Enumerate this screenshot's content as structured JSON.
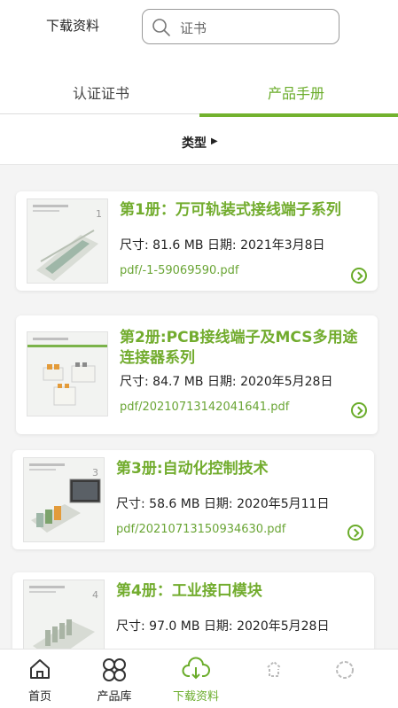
{
  "header": {
    "title": "下载资料",
    "search_placeholder": "证书"
  },
  "tabs": [
    {
      "label": "认证证书",
      "active": false
    },
    {
      "label": "产品手册",
      "active": true
    }
  ],
  "filter": {
    "label": "类型",
    "arrow": "▶"
  },
  "items": [
    {
      "title": "第1册：万可轨装式接线端子系列",
      "size_label": "尺寸: 81.6 MB",
      "date_label": "日期: 2021年3月8日",
      "path": "pdf/-1-59069590.pdf",
      "thumb_num": "1"
    },
    {
      "title": "第2册:PCB接线端子及MCS多用途连接器系列",
      "size_label": "尺寸: 84.7 MB",
      "date_label": "日期: 2020年5月28日",
      "path": "pdf/20210713142041641.pdf",
      "thumb_num": ""
    },
    {
      "title": "第3册:自动化控制技术",
      "size_label": "尺寸: 58.6 MB",
      "date_label": "日期: 2020年5月11日",
      "path": "pdf/20210713150934630.pdf",
      "thumb_num": "3"
    },
    {
      "title": "第4册：工业接口模块",
      "size_label": "尺寸: 97.0 MB",
      "date_label": "日期: 2020年5月28日",
      "path": "",
      "thumb_num": "4"
    }
  ],
  "tabbar": [
    {
      "label": "首页",
      "icon": "home-icon",
      "active": false
    },
    {
      "label": "产品库",
      "icon": "product-library-icon",
      "active": false
    },
    {
      "label": "下载资料",
      "icon": "download-cloud-icon",
      "active": true
    },
    {
      "label": "",
      "icon": "blurred-icon",
      "active": false
    },
    {
      "label": "",
      "icon": "blurred-icon",
      "active": false
    }
  ],
  "colors": {
    "accent": "#72b22e",
    "link": "#6aa535"
  }
}
